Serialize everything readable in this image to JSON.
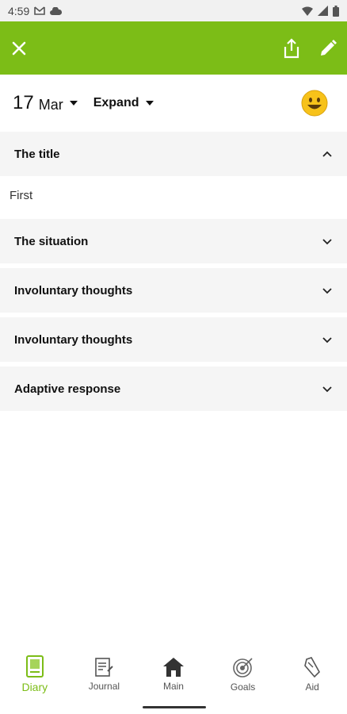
{
  "status_bar": {
    "time": "4:59"
  },
  "date": {
    "day": "17",
    "month": "Mar"
  },
  "expand_label": "Expand",
  "sections": [
    {
      "title": "The title",
      "expanded": true,
      "content": "First"
    },
    {
      "title": "The situation",
      "expanded": false
    },
    {
      "title": "Involuntary thoughts",
      "expanded": false
    },
    {
      "title": "Involuntary thoughts",
      "expanded": false
    },
    {
      "title": "Adaptive response",
      "expanded": false
    }
  ],
  "nav": [
    {
      "label": "Diary",
      "icon": "diary-icon",
      "active": true
    },
    {
      "label": "Journal",
      "icon": "journal-icon",
      "active": false
    },
    {
      "label": "Main",
      "icon": "home-icon",
      "active": false
    },
    {
      "label": "Goals",
      "icon": "target-icon",
      "active": false
    },
    {
      "label": "Aid",
      "icon": "aid-icon",
      "active": false
    }
  ],
  "colors": {
    "accent": "#7cbd17",
    "section_bg": "#f5f5f5"
  }
}
